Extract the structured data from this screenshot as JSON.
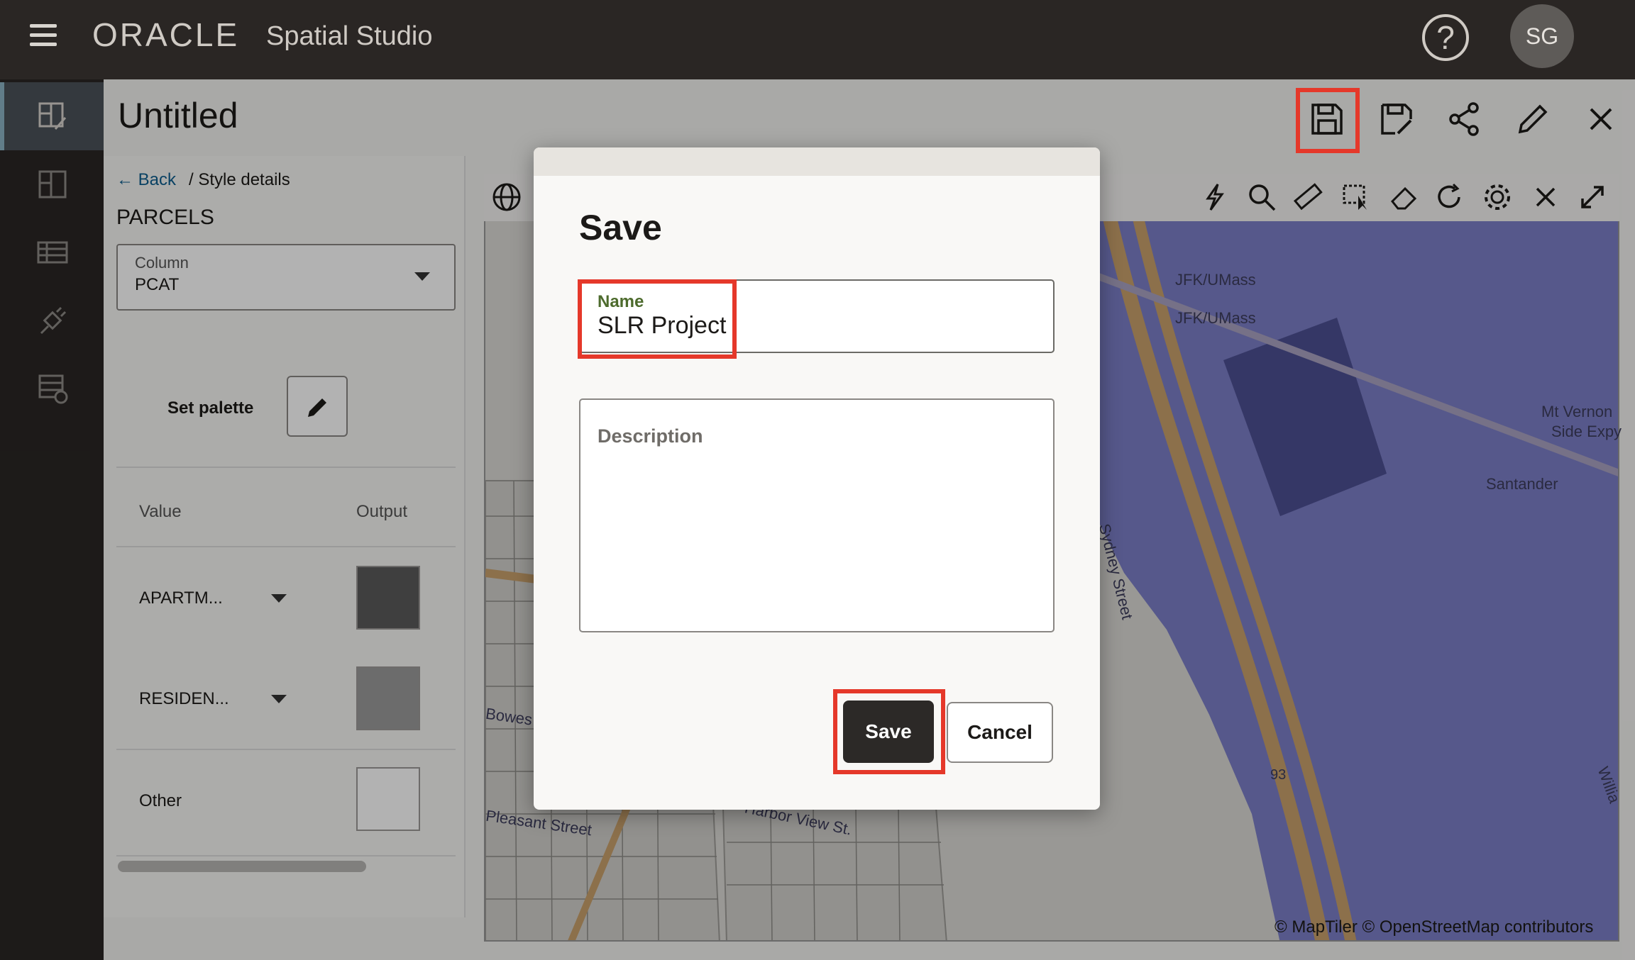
{
  "app": {
    "brand": "ORACLE",
    "product": "Spatial Studio",
    "help": "?",
    "avatar_initials": "SG"
  },
  "project": {
    "title": "Untitled"
  },
  "toolbar": [
    "save-icon",
    "save-as-icon",
    "share-icon",
    "edit-icon",
    "close-icon"
  ],
  "rail": [
    "edit-layout-icon",
    "layout-icon",
    "table-icon",
    "connect-icon",
    "dataset-icon"
  ],
  "style_panel": {
    "back_label": "Back",
    "breadcrumb": "/ Style details",
    "layer_name": "PARCELS",
    "column_label": "Column",
    "column_value": "PCAT",
    "set_palette": "Set palette",
    "value_header": "Value",
    "output_header": "Output",
    "rows": [
      {
        "label": "APARTM...",
        "color": "#5b5b5b"
      },
      {
        "label": "RESIDEN...",
        "color": "#9b9b9b"
      },
      {
        "label": "Other",
        "color": "#ffffff"
      }
    ]
  },
  "map": {
    "labels": [
      "JFK/UMass",
      "JFK/UMass",
      "Mt Vernon",
      "Side Expy",
      "Santander",
      "Sydney Street",
      "Harbor View St.",
      "Pleasant Street",
      "Bowes St",
      "93",
      "Willia"
    ],
    "attribution": "© MapTiler  © OpenStreetMap contributors",
    "tools": [
      "lightning-icon",
      "search-icon",
      "ruler-icon",
      "select-area-icon",
      "eraser-icon",
      "refresh-icon",
      "settings-icon",
      "close-icon",
      "fullscreen-icon"
    ]
  },
  "dialog": {
    "title": "Save",
    "name_label": "Name",
    "name_value": "SLR Project",
    "description_placeholder": "Description",
    "save_label": "Save",
    "cancel_label": "Cancel"
  }
}
